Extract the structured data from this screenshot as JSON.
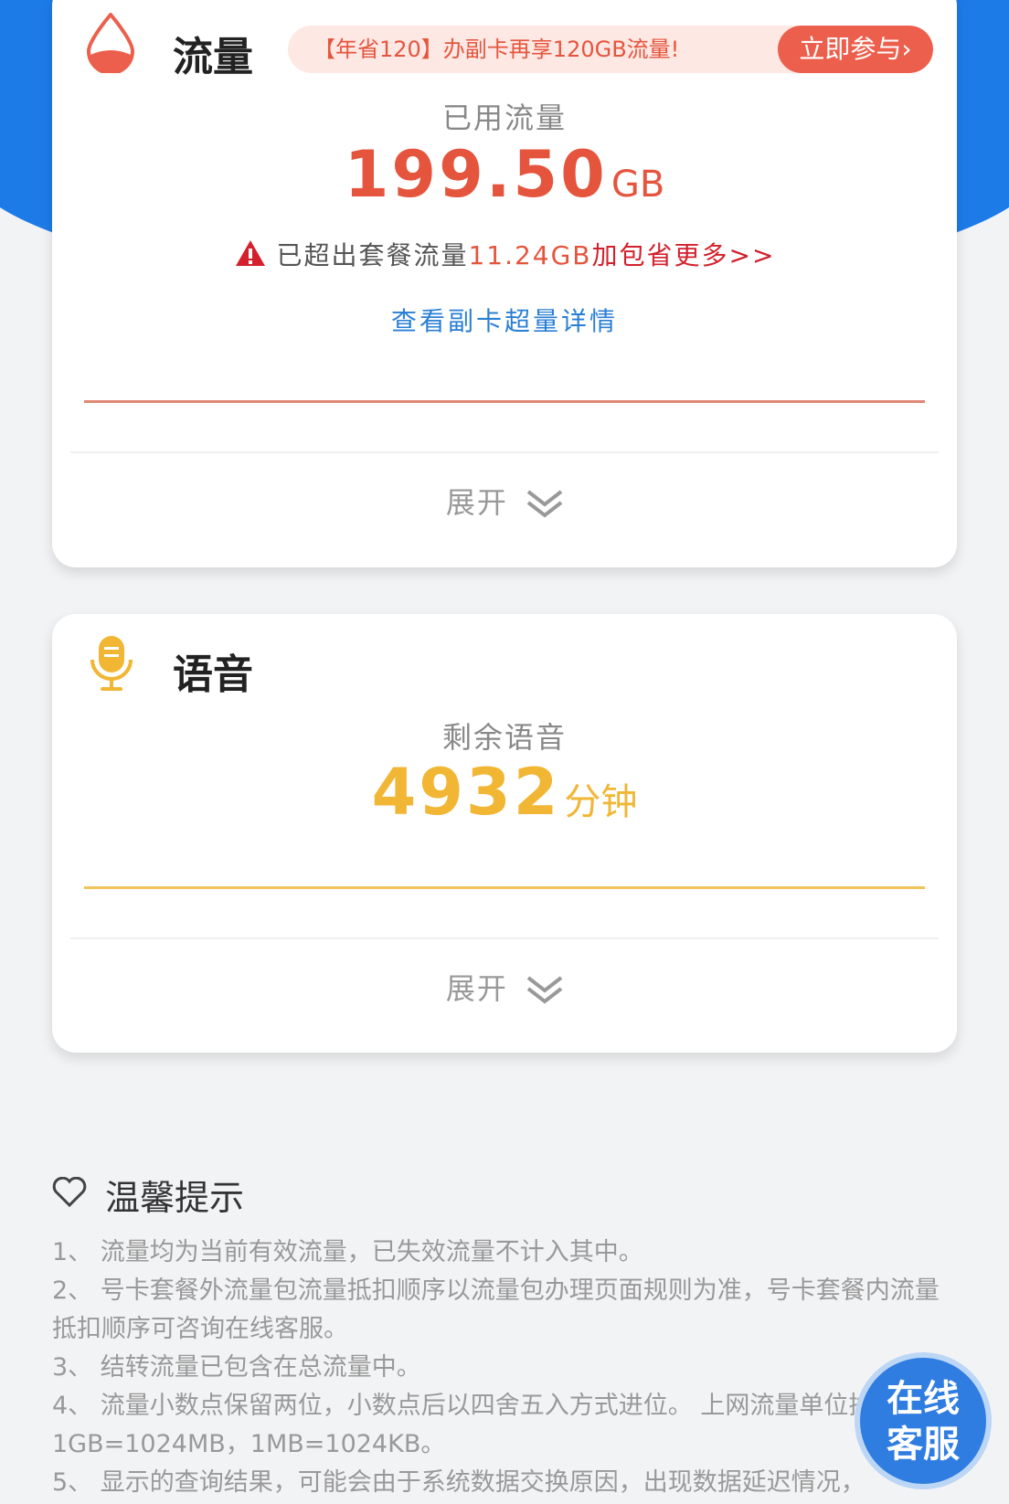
{
  "data_card": {
    "title": "流量",
    "banner_text": "【年省120】办副卡再享120GB流量!",
    "banner_button": "立即参与›",
    "used_label": "已用流量",
    "used_value": "199.50",
    "used_unit": "GB",
    "warning_text": "已超出套餐流量",
    "warning_value": "11.24GB",
    "warning_link": "加包省更多>>",
    "detail_link": "查看副卡超量详情",
    "expand_label": "展开",
    "accent_color": "#e5553e"
  },
  "voice_card": {
    "title": "语音",
    "remain_label": "剩余语音",
    "remain_value": "4932",
    "remain_unit": "分钟",
    "expand_label": "展开",
    "accent_color": "#f1b634"
  },
  "tips": {
    "title": "温馨提示",
    "items": [
      "1、 流量均为当前有效流量，已失效流量不计入其中。",
      "2、 号卡套餐外流量包流量抵扣顺序以流量包办理页面规则为准，号卡套餐内流量抵扣顺序可咨询在线客服。",
      "3、 结转流量已包含在总流量中。",
      "4、 流量小数点保留两位，小数点后以四舍五入方式进位。 上网流量单位换算：1GB=1024MB，1MB=1024KB。",
      "5、 显示的查询结果，可能会由于系统数据交换原因，出现数据延迟情况，"
    ]
  },
  "service_bubble": {
    "line1": "在线",
    "line2": "客服"
  }
}
